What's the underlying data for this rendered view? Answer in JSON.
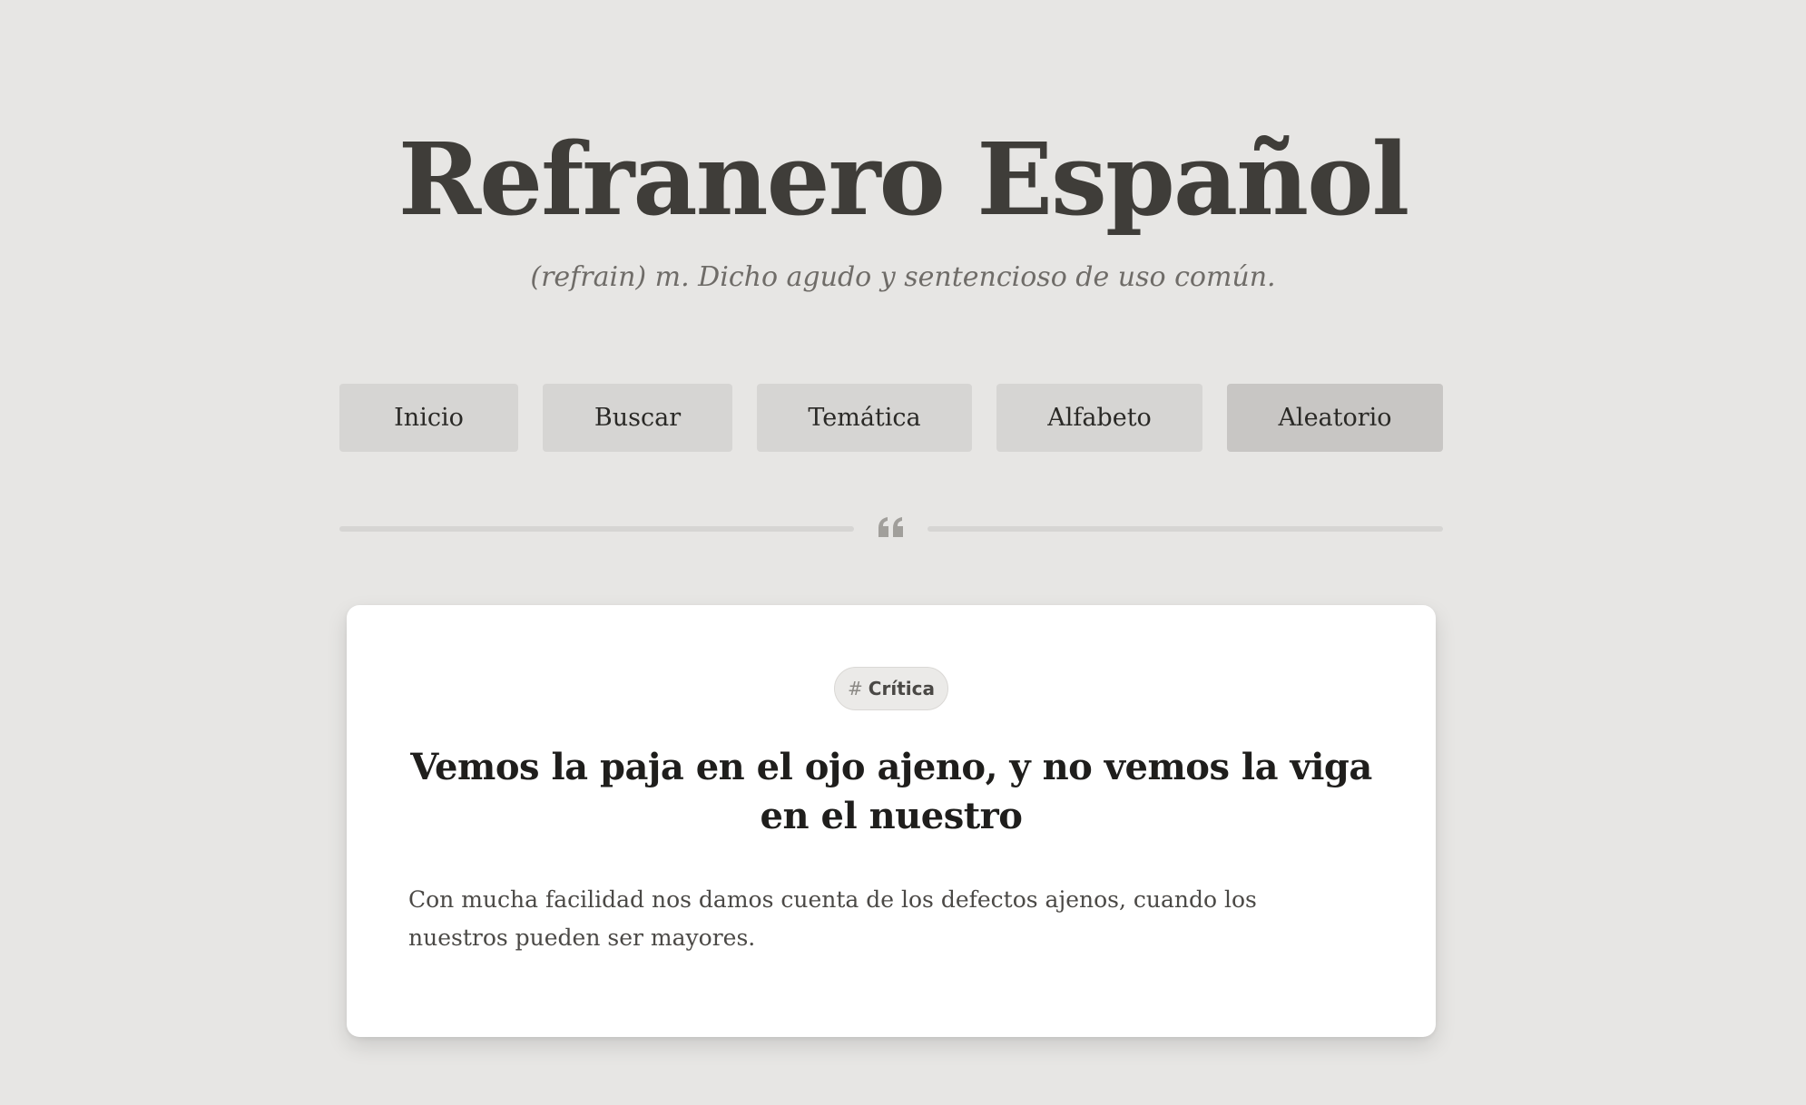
{
  "header": {
    "title": "Refranero Español",
    "subtitle": "(refrain) m. Dicho agudo y sentencioso de uso común."
  },
  "nav": {
    "items": [
      {
        "label": "Inicio",
        "active": false
      },
      {
        "label": "Buscar",
        "active": false
      },
      {
        "label": "Temática",
        "active": false
      },
      {
        "label": "Alfabeto",
        "active": false
      },
      {
        "label": "Aleatorio",
        "active": true
      }
    ]
  },
  "divider": {
    "icon": "quote-icon"
  },
  "card": {
    "tag": {
      "symbol": "#",
      "label": "Crítica"
    },
    "title": "Vemos la paja en el ojo ajeno, y no vemos la viga en el nuestro",
    "meaning": "Con mucha facilidad nos damos cuenta de los defectos ajenos, cuando los nuestros pueden ser mayores."
  },
  "colors": {
    "background": "#e7e6e4",
    "title": "#3f3d39",
    "nav_button": "#d6d5d3",
    "nav_button_active": "#c8c6c4",
    "card": "#ffffff"
  }
}
